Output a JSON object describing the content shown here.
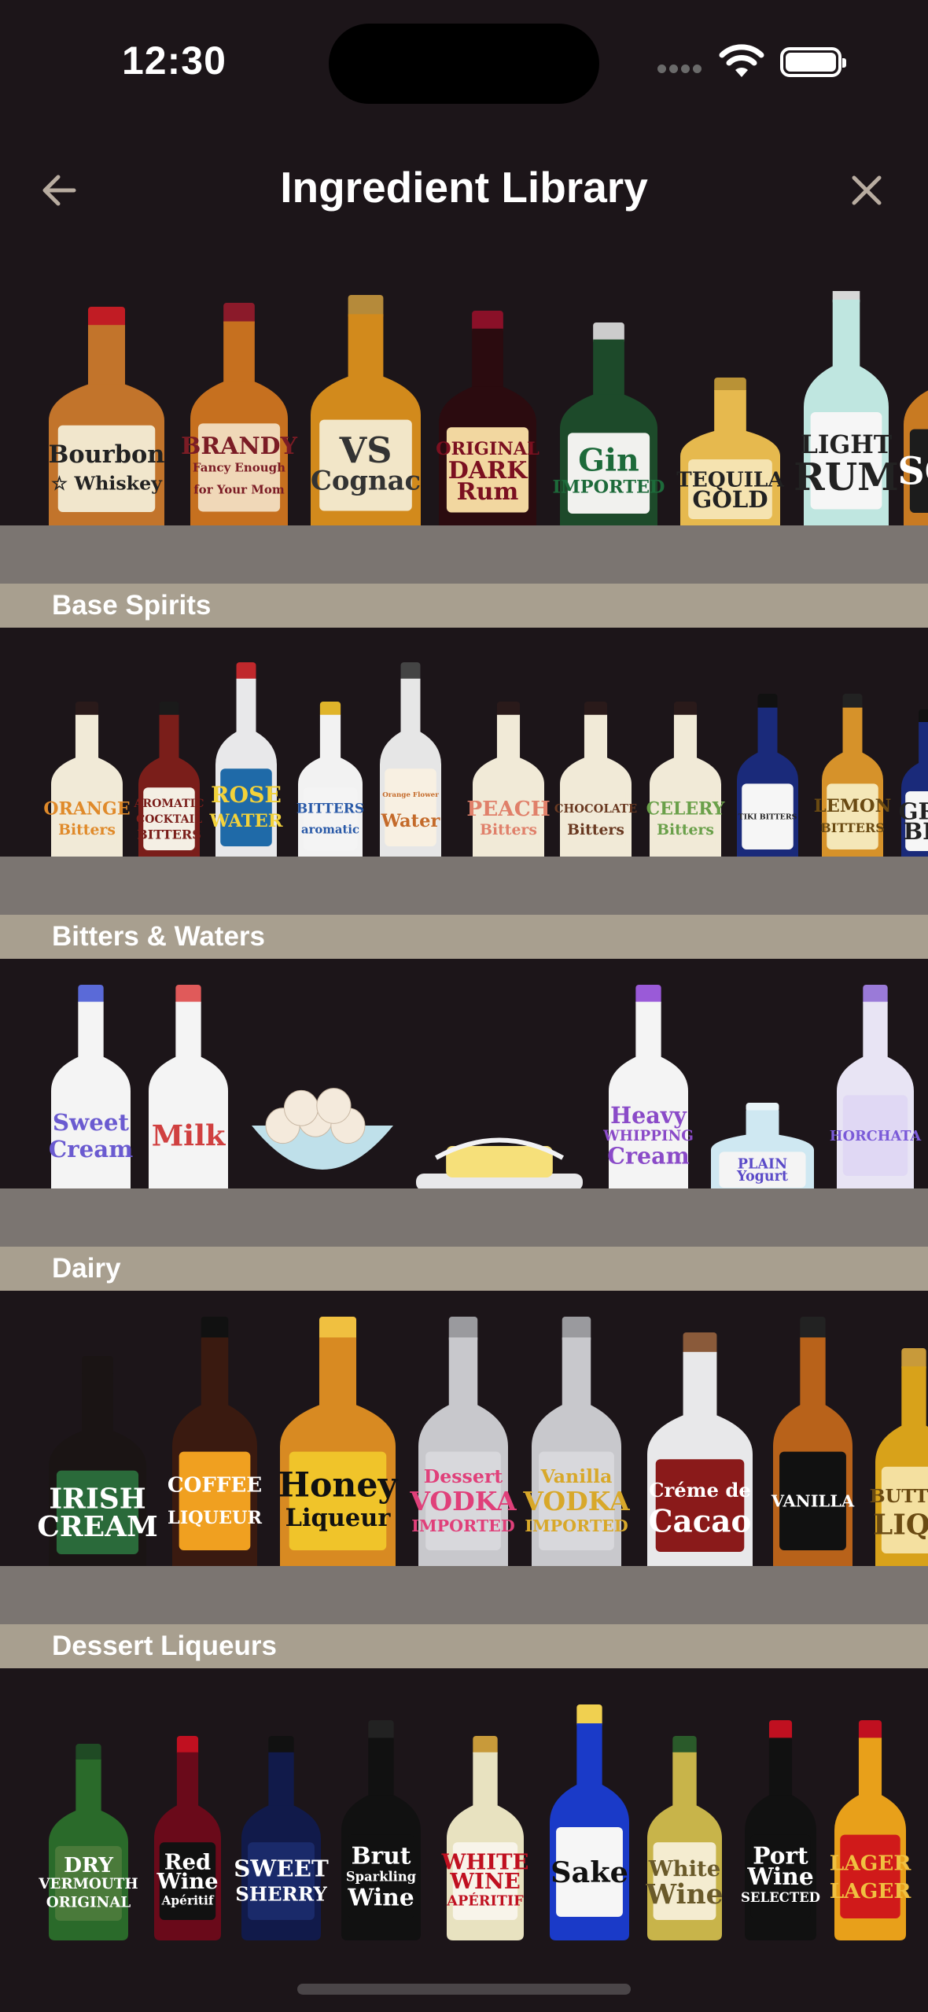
{
  "status_bar": {
    "time": "12:30"
  },
  "nav": {
    "title": "Ingredient Library"
  },
  "shelves": [
    {
      "label": "Base Spirits",
      "items": [
        {
          "name": "bourbon-whiskey",
          "lines": [
            "Bourbon",
            "☆ Whiskey"
          ],
          "glass": "#c2742b",
          "label_bg": "#f1e6cc",
          "cap": "#c11c24",
          "text": "#222"
        },
        {
          "name": "brandy",
          "lines": [
            "BRANDY",
            "Fancy Enough",
            "for Your Mom"
          ],
          "glass": "#c6701f",
          "label_bg": "#f0d8b8",
          "cap": "#8b1a2a",
          "text": "#7b1c25"
        },
        {
          "name": "cognac",
          "lines": [
            "VS",
            "Cognac"
          ],
          "glass": "#d28a1c",
          "label_bg": "#f2e6c8",
          "cap": "#b58a3a",
          "text": "#333"
        },
        {
          "name": "dark-rum",
          "lines": [
            "ORIGINAL",
            "DARK",
            "Rum"
          ],
          "glass": "#2b0b0f",
          "label_bg": "#f2d7a0",
          "cap": "#8a1028",
          "text": "#7b1020"
        },
        {
          "name": "gin",
          "lines": [
            "Gin",
            "IMPORTED"
          ],
          "glass": "#1d4a2a",
          "label_bg": "#f1f1ee",
          "cap": "#cccccc",
          "text": "#1d6a3a"
        },
        {
          "name": "tequila",
          "lines": [
            "TEQUILA",
            "GOLD"
          ],
          "glass": "#e6b94e",
          "label_bg": "#f5e3b0",
          "cap": "#b99236",
          "text": "#222"
        },
        {
          "name": "light-rum",
          "lines": [
            "LIGHT",
            "RUM"
          ],
          "glass": "#bfe6e0",
          "label_bg": "#f6f6f6",
          "cap": "#d7d7d7",
          "text": "#222"
        },
        {
          "name": "scotch",
          "lines": [
            "SCO"
          ],
          "glass": "#c87a22",
          "label_bg": "#1c1c1c",
          "cap": "#2a2a2a",
          "text": "#fff"
        }
      ]
    },
    {
      "label": "Bitters & Waters",
      "items": [
        {
          "name": "orange-bitters",
          "lines": [
            "ORANGE",
            "Bitters"
          ],
          "glass": "#f1ead7",
          "label_bg": "#f1ead7",
          "cap": "#2a1a1a",
          "text": "#e08a2a"
        },
        {
          "name": "aromatic-cocktail-bitters",
          "lines": [
            "AROMATIC",
            "COCKTAIL",
            "BITTERS"
          ],
          "glass": "#7a1e1a",
          "label_bg": "#f4efe4",
          "cap": "#1a1a1a",
          "text": "#7a1e1a"
        },
        {
          "name": "rose-water",
          "lines": [
            "ROSE",
            "WATER"
          ],
          "glass": "#e8e8ea",
          "label_bg": "#1f6aa8",
          "cap": "#c0282c",
          "text": "#f3d23a"
        },
        {
          "name": "aromatic-bitters",
          "lines": [
            "BITTERS",
            "aromatic"
          ],
          "glass": "#f2f2f2",
          "label_bg": "#f4f4f4",
          "cap": "#e0b42a",
          "text": "#2a5aa8"
        },
        {
          "name": "orange-flower-water",
          "lines": [
            "Orange Flower",
            "Water"
          ],
          "glass": "#e6e6e6",
          "label_bg": "#f8f0e2",
          "cap": "#444",
          "text": "#c46a2a"
        },
        {
          "name": "peach-bitters",
          "lines": [
            "PEACH",
            "Bitters"
          ],
          "glass": "#f1ead7",
          "label_bg": "#f1ead7",
          "cap": "#2a1a1a",
          "text": "#e0806a"
        },
        {
          "name": "chocolate-bitters",
          "lines": [
            "CHOCOLATE",
            "Bitters"
          ],
          "glass": "#f1ead7",
          "label_bg": "#f1ead7",
          "cap": "#2a1a1a",
          "text": "#6a3a22"
        },
        {
          "name": "celery-bitters",
          "lines": [
            "CELERY",
            "Bitters"
          ],
          "glass": "#f1ead7",
          "label_bg": "#f1ead7",
          "cap": "#2a1a1a",
          "text": "#6aa04a"
        },
        {
          "name": "tiki-bitters",
          "lines": [
            "TIKI BITTERS"
          ],
          "glass": "#1a2a7a",
          "label_bg": "#f6f6f6",
          "cap": "#111",
          "text": "#222"
        },
        {
          "name": "lemon-bitters",
          "lines": [
            "LEMON",
            "BITTERS"
          ],
          "glass": "#d6922a",
          "label_bg": "#f4e7b8",
          "cap": "#222",
          "text": "#6a4a12"
        },
        {
          "name": "grapefruit-bitters",
          "lines": [
            "GRA",
            "BIT"
          ],
          "glass": "#1a2a7a",
          "label_bg": "#f6f6f6",
          "cap": "#111",
          "text": "#222"
        }
      ]
    },
    {
      "label": "Dairy",
      "items": [
        {
          "name": "sweet-cream",
          "lines": [
            "Sweet",
            "Cream"
          ],
          "glass": "#f4f4f4",
          "label_bg": "#f4f4f4",
          "cap": "#5a6ad8",
          "text": "#6a5ad0"
        },
        {
          "name": "milk",
          "lines": [
            "Milk"
          ],
          "glass": "#f4f4f4",
          "label_bg": "#f4f4f4",
          "cap": "#e05a5a",
          "text": "#d04040"
        },
        {
          "name": "eggs",
          "lines": [],
          "glass": "#bfe0ea",
          "label_bg": "#bfe0ea",
          "cap": "#f4eadc",
          "text": "#222"
        },
        {
          "name": "butter",
          "lines": [],
          "glass": "#f4f4f4",
          "label_bg": "#f6e07a",
          "cap": "#f4f4f4",
          "text": "#222"
        },
        {
          "name": "heavy-whipping-cream",
          "lines": [
            "Heavy",
            "WHIPPING",
            "Cream"
          ],
          "glass": "#f4f4f4",
          "label_bg": "#f4f4f4",
          "cap": "#9a5ad8",
          "text": "#8a4ac8"
        },
        {
          "name": "plain-yogurt",
          "lines": [
            "PLAIN",
            "Yogurt"
          ],
          "glass": "#cfe8f2",
          "label_bg": "#f4f4f4",
          "cap": "#e8f4f8",
          "text": "#5a4ac8"
        },
        {
          "name": "horchata",
          "lines": [
            "HORCHATA"
          ],
          "glass": "#e8e4f4",
          "label_bg": "#e0d8f4",
          "cap": "#9a7ad8",
          "text": "#7a5ad8"
        }
      ]
    },
    {
      "label": "Dessert Liqueurs",
      "items": [
        {
          "name": "irish-cream",
          "lines": [
            "IRISH",
            "CREAM"
          ],
          "glass": "#1a1414",
          "label_bg": "#2a6a3a",
          "cap": "#1a1414",
          "text": "#fff"
        },
        {
          "name": "coffee-liqueur",
          "lines": [
            "COFFEE",
            "LIQUEUR"
          ],
          "glass": "#3a1a10",
          "label_bg": "#f0a020",
          "cap": "#111",
          "text": "#fff"
        },
        {
          "name": "honey-liqueur",
          "lines": [
            "Honey",
            "Liqueur"
          ],
          "glass": "#d88a22",
          "label_bg": "#f0c42a",
          "cap": "#f0c040",
          "text": "#111"
        },
        {
          "name": "dessert-vodka",
          "lines": [
            "Dessert",
            "VODKA",
            "IMPORTED"
          ],
          "glass": "#c8c8cc",
          "label_bg": "#d8d8dc",
          "cap": "#9a9a9e",
          "text": "#e0407a"
        },
        {
          "name": "vanilla-vodka",
          "lines": [
            "Vanilla",
            "VODKA",
            "IMPORTED"
          ],
          "glass": "#c8c8cc",
          "label_bg": "#d8d8dc",
          "cap": "#9a9a9e",
          "text": "#d8a82a"
        },
        {
          "name": "creme-de-cacao",
          "lines": [
            "Créme de",
            "Cacao"
          ],
          "glass": "#e8e8ea",
          "label_bg": "#8a1a1a",
          "cap": "#8a5a3a",
          "text": "#fff"
        },
        {
          "name": "vanilla-liqueur",
          "lines": [
            "VANILLA"
          ],
          "glass": "#b8621a",
          "label_bg": "#111",
          "cap": "#222",
          "text": "#fff"
        },
        {
          "name": "butterscotch-liqueur",
          "lines": [
            "BUTTER",
            "LIQU"
          ],
          "glass": "#d8a21a",
          "label_bg": "#f4e0a0",
          "cap": "#c89a3a",
          "text": "#6a4a12"
        }
      ]
    },
    {
      "label": "",
      "items": [
        {
          "name": "dry-vermouth",
          "lines": [
            "DRY",
            "VERMOUTH",
            "ORIGINAL"
          ],
          "glass": "#2a6a2a",
          "label_bg": "#4a7a3a",
          "cap": "#1f4a24",
          "text": "#fff"
        },
        {
          "name": "red-wine-aperitif",
          "lines": [
            "Red",
            "Wine",
            "Apéritif"
          ],
          "glass": "#6a0a1a",
          "label_bg": "#111",
          "cap": "#c01020",
          "text": "#fff"
        },
        {
          "name": "sweet-sherry",
          "lines": [
            "SWEET",
            "SHERRY"
          ],
          "glass": "#111a4a",
          "label_bg": "#1a2a6a",
          "cap": "#111",
          "text": "#fff"
        },
        {
          "name": "sparkling-wine",
          "lines": [
            "Brut",
            "Sparkling",
            "Wine"
          ],
          "glass": "#111",
          "label_bg": "#111",
          "cap": "#222",
          "text": "#fff"
        },
        {
          "name": "white-wine-aperitif",
          "lines": [
            "WHITE",
            "WINE",
            "APÉRITIF"
          ],
          "glass": "#e8e2c0",
          "label_bg": "#f8f4ea",
          "cap": "#c89a3a",
          "text": "#c01020"
        },
        {
          "name": "sake",
          "lines": [
            "Sake"
          ],
          "glass": "#1a3ac8",
          "label_bg": "#f6f6f6",
          "cap": "#f0d050",
          "text": "#111"
        },
        {
          "name": "white-wine",
          "lines": [
            "White",
            "Wine"
          ],
          "glass": "#c8b44a",
          "label_bg": "#f4ecd0",
          "cap": "#2a5a2a",
          "text": "#6a5a2a"
        },
        {
          "name": "port-wine",
          "lines": [
            "Port",
            "Wine",
            "SELECTED"
          ],
          "glass": "#111",
          "label_bg": "#111",
          "cap": "#c01020",
          "text": "#fff"
        },
        {
          "name": "lager",
          "lines": [
            "LAGER",
            "LAGER"
          ],
          "glass": "#e8a01a",
          "label_bg": "#d01a1a",
          "cap": "#c01020",
          "text": "#f0c040"
        }
      ]
    }
  ]
}
